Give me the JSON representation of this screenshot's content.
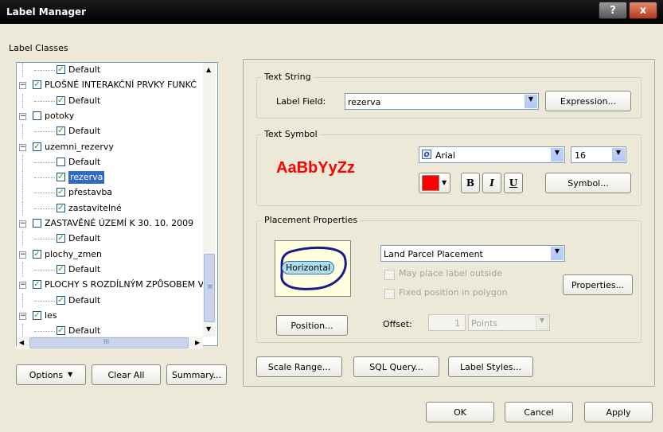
{
  "window": {
    "title": "Label Manager",
    "help_btn": "?",
    "close_btn": "x"
  },
  "left": {
    "label_classes": "Label Classes",
    "tree": [
      {
        "text": "Default",
        "level": 2,
        "checked": true,
        "expander": ""
      },
      {
        "text": "PLOŠNÉ INTERAKČNÍ PRVKY FUNKČ",
        "level": 1,
        "checked": true,
        "expander": "−"
      },
      {
        "text": "Default",
        "level": 2,
        "checked": true,
        "expander": ""
      },
      {
        "text": "potoky",
        "level": 1,
        "checked": false,
        "expander": "−"
      },
      {
        "text": "Default",
        "level": 2,
        "checked": true,
        "expander": ""
      },
      {
        "text": "uzemni_rezervy",
        "level": 1,
        "checked": true,
        "expander": "−"
      },
      {
        "text": "Default",
        "level": 2,
        "checked": false,
        "expander": ""
      },
      {
        "text": "rezerva",
        "level": 2,
        "checked": true,
        "expander": "",
        "selected": true
      },
      {
        "text": "přestavba",
        "level": 2,
        "checked": true,
        "expander": ""
      },
      {
        "text": "zastavitelné",
        "level": 2,
        "checked": true,
        "expander": ""
      },
      {
        "text": "ZASTAVĚNÉ ÚZEMÍ K 30. 10. 2009",
        "level": 1,
        "checked": false,
        "expander": "−"
      },
      {
        "text": "Default",
        "level": 2,
        "checked": true,
        "expander": ""
      },
      {
        "text": "plochy_zmen",
        "level": 1,
        "checked": true,
        "expander": "−"
      },
      {
        "text": "Default",
        "level": 2,
        "checked": true,
        "expander": ""
      },
      {
        "text": "PLOCHY S ROZDÍLNÝM ZPŮSOBEM V",
        "level": 1,
        "checked": true,
        "expander": "−"
      },
      {
        "text": "Default",
        "level": 2,
        "checked": true,
        "expander": ""
      },
      {
        "text": "les",
        "level": 1,
        "checked": true,
        "expander": "−"
      },
      {
        "text": "Default",
        "level": 2,
        "checked": true,
        "expander": ""
      }
    ],
    "scroll_grip": "≡",
    "hscroll_grip": "III",
    "options_btn": "Options",
    "clear_all_btn": "Clear All",
    "summary_btn": "Summary..."
  },
  "text_string": {
    "group": "Text String",
    "label_field_caption": "Label Field:",
    "label_field_value": "rezerva",
    "expression_btn": "Expression..."
  },
  "text_symbol": {
    "group": "Text Symbol",
    "preview": "AaBbYyZz",
    "preview_color": "#ff0000",
    "font": "Arial",
    "size": "16",
    "bold": "B",
    "italic": "I",
    "underline": "U",
    "symbol_btn": "Symbol..."
  },
  "placement": {
    "group": "Placement Properties",
    "preview_label": "Horizontal",
    "position_btn": "Position...",
    "placement_select": "Land Parcel Placement",
    "may_place_outside": "May place label outside",
    "fixed_position": "Fixed position in polygon",
    "properties_btn": "Properties...",
    "offset_caption": "Offset:",
    "offset_value": "1",
    "offset_units": "Points"
  },
  "bottom_buttons": {
    "scale_range": "Scale Range...",
    "sql_query": "SQL Query...",
    "label_styles": "Label Styles..."
  },
  "dialog_buttons": {
    "ok": "OK",
    "cancel": "Cancel",
    "apply": "Apply"
  }
}
